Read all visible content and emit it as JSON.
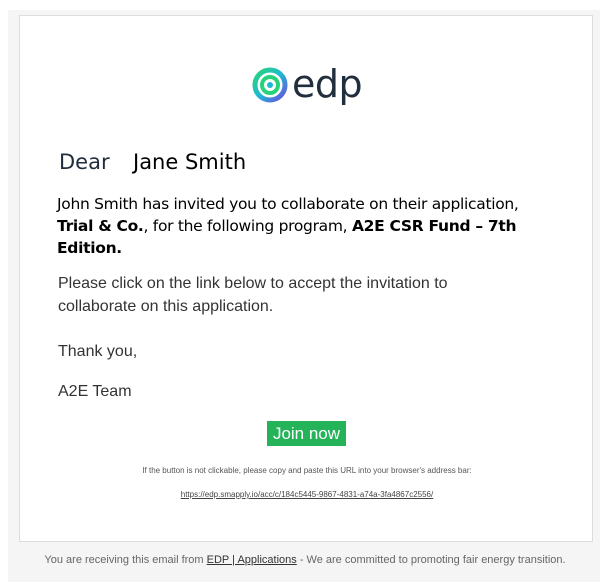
{
  "logo": {
    "text": "edp",
    "icon": "edp-swirl-icon"
  },
  "greeting": {
    "dear": "Dear",
    "name": "Jane Smith"
  },
  "intro": {
    "prefix": "John Smith has invited you to collaborate on their application,",
    "application": "Trial & Co.",
    "middle": ", for the following program,",
    "program": "A2E CSR Fund – 7th Edition."
  },
  "body": {
    "instructions": "Please click on the link below to accept the invitation to collaborate on this application.",
    "thanks": "Thank you,",
    "signature": "A2E Team"
  },
  "button": {
    "label": "Join now",
    "color": "#25b35a"
  },
  "fallback": {
    "hint": "If the button is not clickable, please copy and paste this URL into your browser's address bar:",
    "url": "https://edp.smapply.io/acc/c/184c5445-9867-4831-a74a-3fa4867c2556/"
  },
  "footer": {
    "prefix": "You are receiving this email from",
    "link": "EDP | Applications",
    "suffix": "- We are committed to promoting fair energy transition."
  }
}
